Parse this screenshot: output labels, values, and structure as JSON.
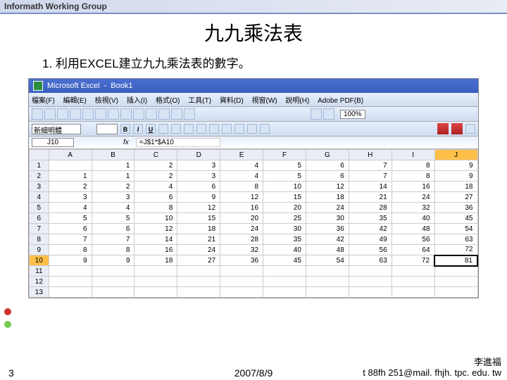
{
  "header": "Informath Working Group",
  "title": "九九乘法表",
  "subtitle": "1. 利用EXCEL建立九九乘法表的數字。",
  "excel": {
    "app": "Microsoft Excel",
    "book": "Book1",
    "menus": [
      "檔案(F)",
      "編輯(E)",
      "檢視(V)",
      "插入(I)",
      "格式(O)",
      "工具(T)",
      "資料(D)",
      "視窗(W)",
      "說明(H)",
      "Adobe PDF(B)"
    ],
    "zoom": "100%",
    "font": "新細明體",
    "fmt_b": "B",
    "fmt_i": "I",
    "fmt_u": "U",
    "namebox": "J10",
    "fx": "fx",
    "formula": "=J$1*$A10"
  },
  "chart_data": {
    "type": "table",
    "title": "九九乘法表 (9×9 multiplication table)",
    "columns": [
      "",
      "A",
      "B",
      "C",
      "D",
      "E",
      "F",
      "G",
      "H",
      "I",
      "J"
    ],
    "rows": [
      [
        "1",
        "",
        "1",
        "2",
        "3",
        "4",
        "5",
        "6",
        "7",
        "8",
        "9"
      ],
      [
        "2",
        "1",
        "1",
        "2",
        "3",
        "4",
        "5",
        "6",
        "7",
        "8",
        "9"
      ],
      [
        "3",
        "2",
        "2",
        "4",
        "6",
        "8",
        "10",
        "12",
        "14",
        "16",
        "18"
      ],
      [
        "4",
        "3",
        "3",
        "6",
        "9",
        "12",
        "15",
        "18",
        "21",
        "24",
        "27"
      ],
      [
        "5",
        "4",
        "4",
        "8",
        "12",
        "16",
        "20",
        "24",
        "28",
        "32",
        "36"
      ],
      [
        "6",
        "5",
        "5",
        "10",
        "15",
        "20",
        "25",
        "30",
        "35",
        "40",
        "45"
      ],
      [
        "7",
        "6",
        "6",
        "12",
        "18",
        "24",
        "30",
        "36",
        "42",
        "48",
        "54"
      ],
      [
        "8",
        "7",
        "7",
        "14",
        "21",
        "28",
        "35",
        "42",
        "49",
        "56",
        "63"
      ],
      [
        "9",
        "8",
        "8",
        "16",
        "24",
        "32",
        "40",
        "48",
        "56",
        "64",
        "72"
      ],
      [
        "10",
        "9",
        "9",
        "18",
        "27",
        "36",
        "45",
        "54",
        "63",
        "72",
        "81"
      ],
      [
        "11",
        "",
        "",
        "",
        "",
        "",
        "",
        "",
        "",
        "",
        ""
      ],
      [
        "12",
        "",
        "",
        "",
        "",
        "",
        "",
        "",
        "",
        "",
        ""
      ],
      [
        "13",
        "",
        "",
        "",
        "",
        "",
        "",
        "",
        "",
        "",
        ""
      ]
    ],
    "selected_cell": "J10",
    "selected_value": 81
  },
  "footer": {
    "page": "3",
    "date": "2007/8/9",
    "author": "李進福",
    "email": "t 88fh 251@mail. fhjh. tpc. edu. tw"
  }
}
